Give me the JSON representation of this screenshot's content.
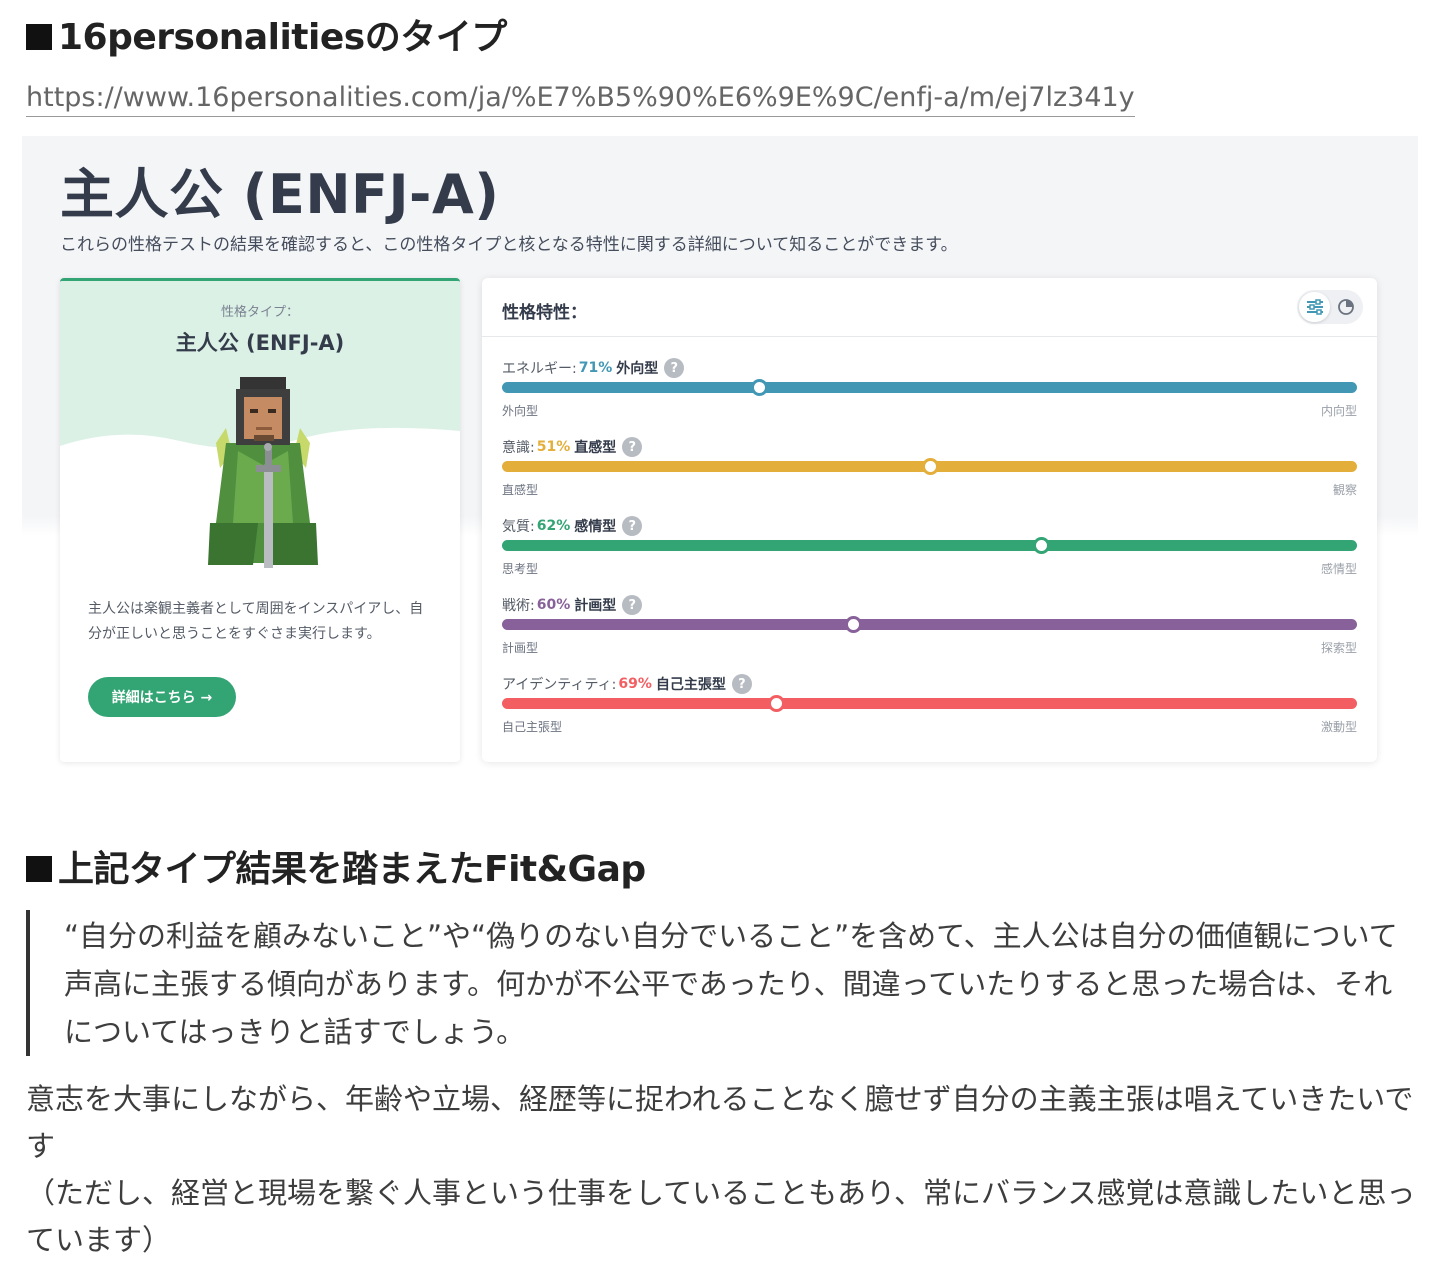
{
  "headings": {
    "top": "16personalitiesのタイプ",
    "fit_gap": "上記タイプ結果を踏まえたFit&Gap"
  },
  "reference_url": "https://www.16personalities.com/ja/%E7%B5%90%E6%9E%9C/enfj-a/m/ej7lz341y",
  "screenshot": {
    "title": "主人公 (ENFJ-A)",
    "description": "これらの性格テストの結果を確認すると、この性格タイプと核となる特性に関する詳細について知ることができます。",
    "type_card": {
      "label": "性格タイプ：",
      "name": "主人公 (ENFJ-A)",
      "description": "主人公は楽観主義者として周囲をインスパイアし、自分が正しいと思うことをすぐさま実行します。",
      "button_label": "詳細はこちら →"
    },
    "traits_card": {
      "title": "性格特性：",
      "traits": [
        {
          "name": "エネルギー:",
          "percent": "71%",
          "side": "外向型",
          "left_label": "外向型",
          "right_label": "内向型",
          "color": "#4298b4",
          "position": 0.3
        },
        {
          "name": "意識:",
          "percent": "51%",
          "side": "直感型",
          "left_label": "直感型",
          "right_label": "観察",
          "color": "#e4ae3a",
          "position": 0.5
        },
        {
          "name": "気質:",
          "percent": "62%",
          "side": "感情型",
          "left_label": "思考型",
          "right_label": "感情型",
          "color": "#33a474",
          "position": 0.63
        },
        {
          "name": "戦術:",
          "percent": "60%",
          "side": "計画型",
          "left_label": "計画型",
          "right_label": "探索型",
          "color": "#88619a",
          "position": 0.41
        },
        {
          "name": "アイデンティティ:",
          "percent": "69%",
          "side": "自己主張型",
          "left_label": "自己主張型",
          "right_label": "激動型",
          "color": "#f25e62",
          "position": 0.32
        }
      ]
    }
  },
  "quote": "“自分の利益を顧みないこと”や“偽りのない自分でいること”を含めて、主人公は自分の価値観について声高に主張する傾向があります。何かが不公平であったり、間違っていたりすると思った場合は、それについてはっきりと話すでしょう。",
  "body_lines": [
    "意志を大事にしながら、年齢や立場、経歴等に捉われることなく臆せず自分の主義主張は唱えていきたいです",
    "（ただし、経営と現場を繋ぐ人事という仕事をしていることもあり、常にバランス感覚は意識したいと思っています）"
  ]
}
